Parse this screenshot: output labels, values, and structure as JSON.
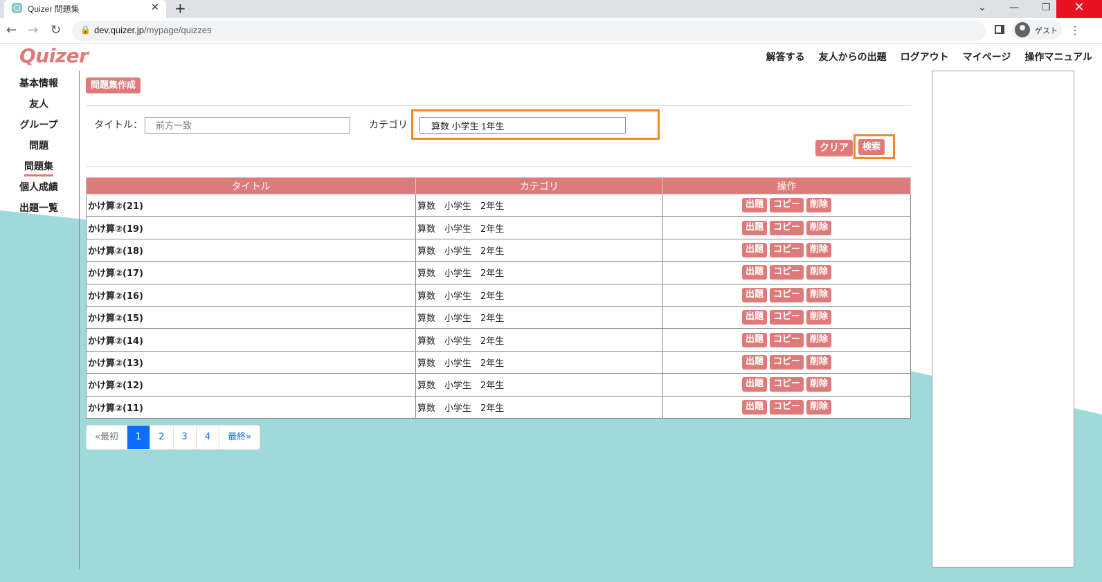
{
  "browser": {
    "tab_title": "Quizer 問題集",
    "url_host": "dev.quizer.jp",
    "url_path": "/mypage/quizzes",
    "profile_label": "ゲスト"
  },
  "logo": "Quizer",
  "topnav": [
    "解答する",
    "友人からの出題",
    "ログアウト",
    "マイページ",
    "操作マニュアル"
  ],
  "sidebar": [
    "基本情報",
    "友人",
    "グループ",
    "問題",
    "問題集",
    "個人成績",
    "出題一覧"
  ],
  "sidebar_active": "問題集",
  "main": {
    "create_button": "問題集作成",
    "title_label": "タイトル：",
    "title_placeholder": "前方一致",
    "category_label": "カテゴリ",
    "category_value": "算数 小学生 1年生",
    "clear_button": "クリア",
    "search_button": "検索"
  },
  "table": {
    "headers": [
      "タイトル",
      "カテゴリ",
      "操作"
    ],
    "rows": [
      {
        "title": "かけ算②(21)",
        "category": "算数　小学生　2年生"
      },
      {
        "title": "かけ算②(19)",
        "category": "算数　小学生　2年生"
      },
      {
        "title": "かけ算②(18)",
        "category": "算数　小学生　2年生"
      },
      {
        "title": "かけ算②(17)",
        "category": "算数　小学生　2年生"
      },
      {
        "title": "かけ算②(16)",
        "category": "算数　小学生　2年生"
      },
      {
        "title": "かけ算②(15)",
        "category": "算数　小学生　2年生"
      },
      {
        "title": "かけ算②(14)",
        "category": "算数　小学生　2年生"
      },
      {
        "title": "かけ算②(13)",
        "category": "算数　小学生　2年生"
      },
      {
        "title": "かけ算②(12)",
        "category": "算数　小学生　2年生"
      },
      {
        "title": "かけ算②(11)",
        "category": "算数　小学生　2年生"
      }
    ],
    "ops": [
      "出題",
      "コピー",
      "削除"
    ]
  },
  "pagination": {
    "first": "«最初",
    "pages": [
      "1",
      "2",
      "3",
      "4"
    ],
    "current": "1",
    "last": "最終»"
  },
  "colors": {
    "accent": "#e07a7a",
    "highlight": "#f0892a",
    "teal": "#9fd9da",
    "pager_active": "#0d6efd"
  }
}
